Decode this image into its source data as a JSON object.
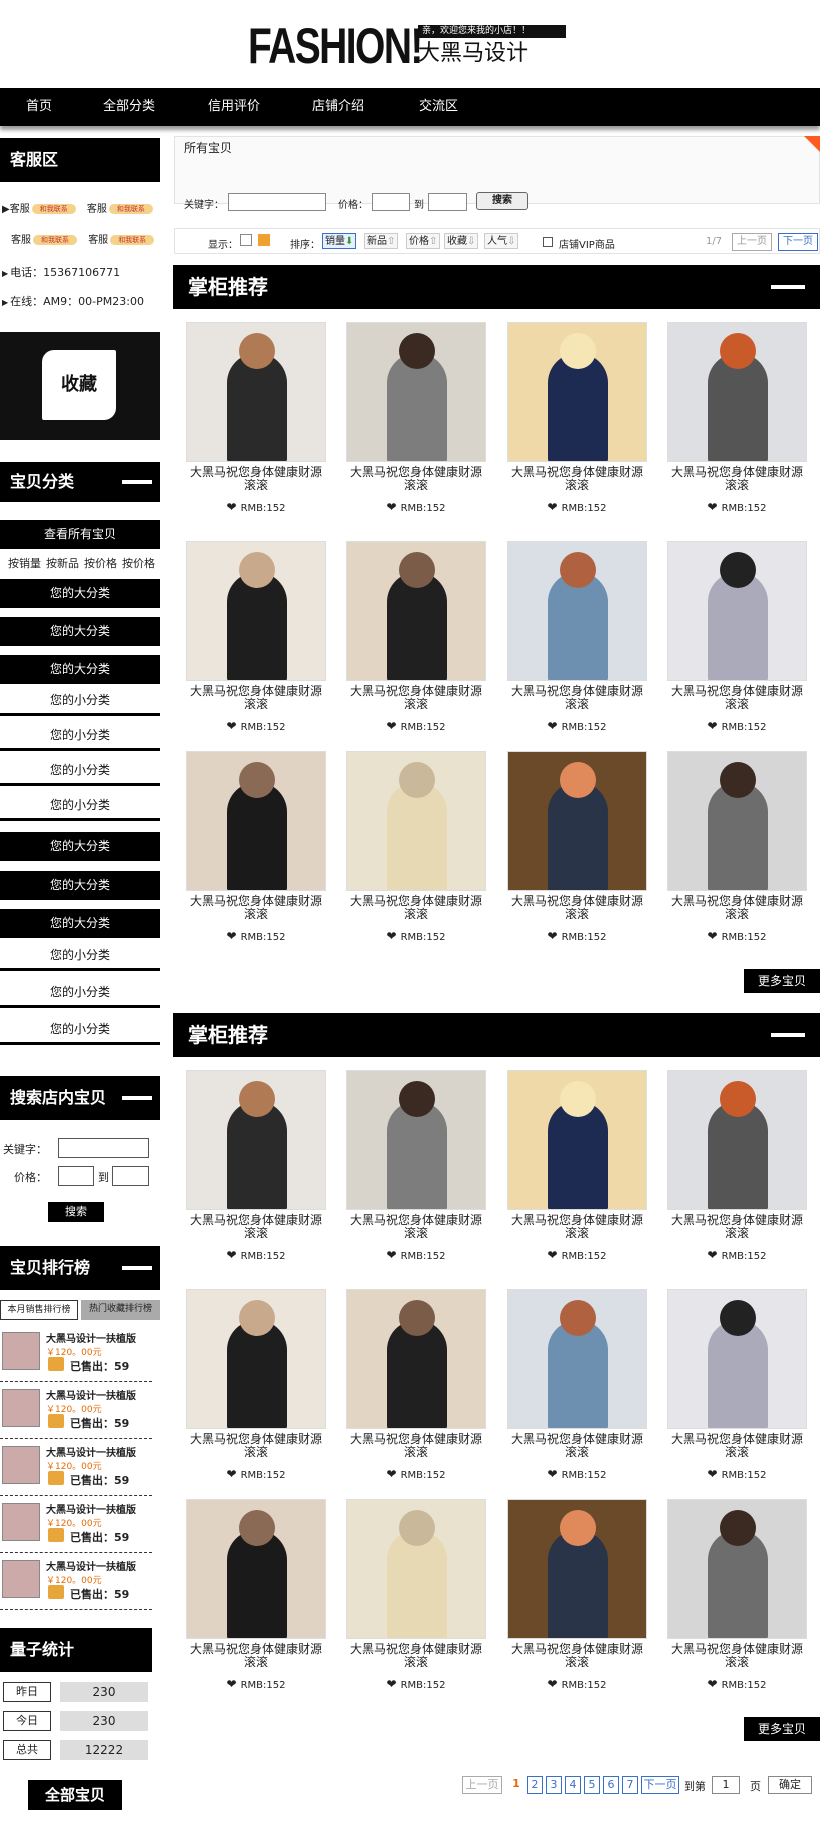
{
  "header": {
    "logo": "FASHION!",
    "greeting": "亲，欢迎您来我的小店！！",
    "shop_name": "大黑马设计"
  },
  "top_nav": [
    "首页",
    "全部分类",
    "信用评价",
    "店铺介绍",
    "交流区"
  ],
  "sidebar": {
    "service_title": "客服区",
    "service_label": "客服",
    "service_badge": "和我联系",
    "phone": "电话：15367106771",
    "hours": "在线：AM9：00-PM23:00",
    "collect_label": "收藏",
    "categories_title": "宝贝分类",
    "view_all": "查看所有宝贝",
    "sort_links": [
      "按销量",
      "按新品",
      "按价格",
      "按价格"
    ],
    "big_category": "您的大分类",
    "small_category": "您的小分类",
    "search_title": "搜索店内宝贝",
    "keyword_label": "关键字：",
    "price_label": "价格：",
    "to_label": "到",
    "search_button": "搜索",
    "ranking_title": "宝贝排行榜",
    "ranking_tabs": [
      "本月销售排行榜",
      "热门收藏排行榜"
    ],
    "ranking_items": [
      {
        "title": "大黑马设计一扶植版",
        "price": "￥120。00元",
        "sold": "已售出：59"
      },
      {
        "title": "大黑马设计一扶植版",
        "price": "￥120。00元",
        "sold": "已售出：59"
      },
      {
        "title": "大黑马设计一扶植版",
        "price": "￥120。00元",
        "sold": "已售出：59"
      },
      {
        "title": "大黑马设计一扶植版",
        "price": "￥120。00元",
        "sold": "已售出：59"
      },
      {
        "title": "大黑马设计一扶植版",
        "price": "￥120。00元",
        "sold": "已售出：59"
      }
    ],
    "stats_title": "量子统计",
    "stats": [
      {
        "label": "昨日",
        "value": "230"
      },
      {
        "label": "今日",
        "value": "230"
      },
      {
        "label": "总共",
        "value": "12222"
      }
    ],
    "all_items": "全部宝贝"
  },
  "main": {
    "breadcrumb": "所有宝贝",
    "keyword_label": "关键字：",
    "price_label": "价格：",
    "to_label": "到",
    "search_button": "搜索",
    "display_label": "显示：",
    "sort_label": "排序：",
    "sort_options": [
      "销量",
      "新品",
      "价格",
      "收藏",
      "人气"
    ],
    "vip_label": "店铺VIP商品",
    "page_indicator": "1/7",
    "prev_page": "上一页",
    "next_page": "下一页",
    "section_title": "掌柜推荐",
    "product_name": "大黑马祝您身体健康财源滚滚",
    "product_price": "RMB:152",
    "more_button": "更多宝贝",
    "pagination": {
      "prev": "上一页",
      "pages": [
        "1",
        "2",
        "3",
        "4",
        "5",
        "6",
        "7"
      ],
      "next": "下一页",
      "goto_label": "到第",
      "goto_value": "1",
      "page_unit": "页",
      "confirm": "确定"
    }
  },
  "colors": {
    "accent": "#000000",
    "price": "#e36c0a",
    "link": "#3a70c8",
    "corner": "#ff5a1f"
  }
}
